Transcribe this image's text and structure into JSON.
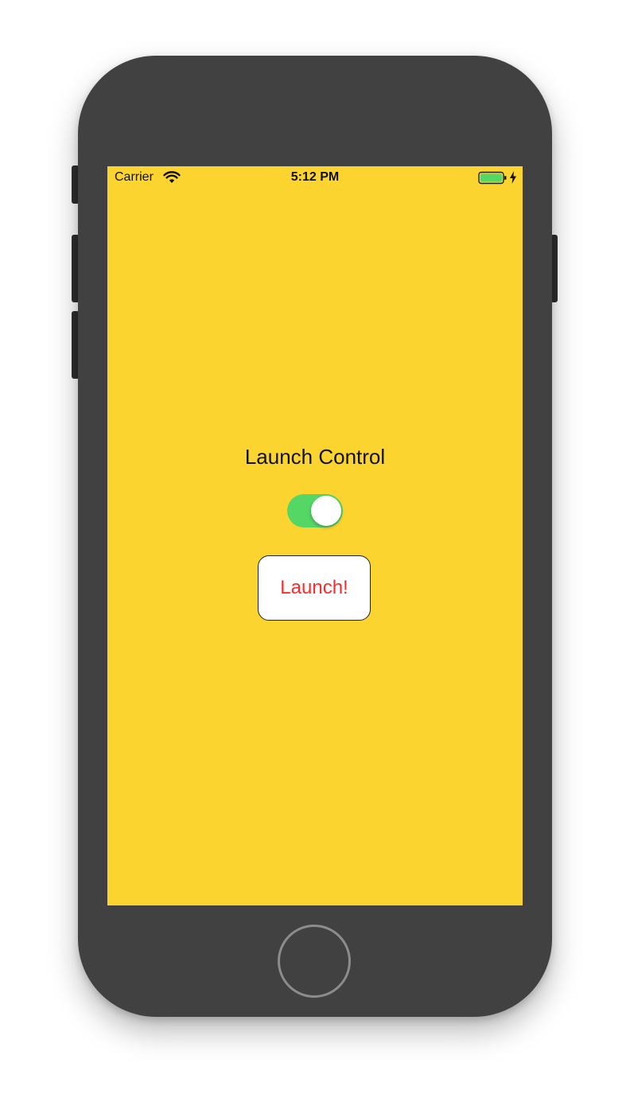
{
  "device": {
    "frame_color": "#414141",
    "screen_background": "#fcd430"
  },
  "status_bar": {
    "carrier": "Carrier",
    "time": "5:12 PM",
    "wifi_icon": "wifi-icon",
    "battery_icon": "battery-charging-icon",
    "battery_color": "#55d766"
  },
  "main": {
    "title": "Launch Control",
    "toggle": {
      "state": "on",
      "on_color": "#55d766"
    },
    "launch_button": {
      "label": "Launch!",
      "text_color": "#ff2a2a"
    }
  }
}
